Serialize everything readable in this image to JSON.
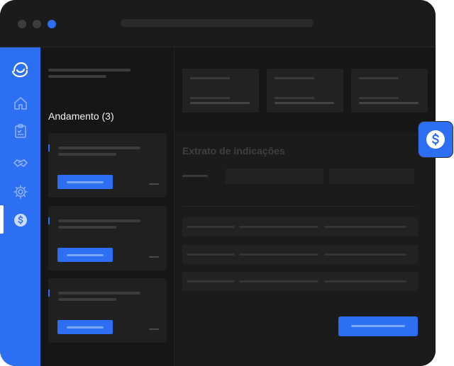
{
  "left_panel": {
    "section_title": "Andamento (3)"
  },
  "main": {
    "extrato_title": "Extrato de indicações"
  },
  "sidebar": {
    "items": [
      {
        "icon": "home-icon"
      },
      {
        "icon": "clipboard-icon"
      },
      {
        "icon": "handshake-icon"
      },
      {
        "icon": "gear-icon"
      },
      {
        "icon": "dollar-coin-icon",
        "active": true
      }
    ]
  },
  "colors": {
    "accent": "#2d6ff2",
    "window_bg": "#141414",
    "panel_bg": "#161616",
    "card_bg": "#202020"
  }
}
